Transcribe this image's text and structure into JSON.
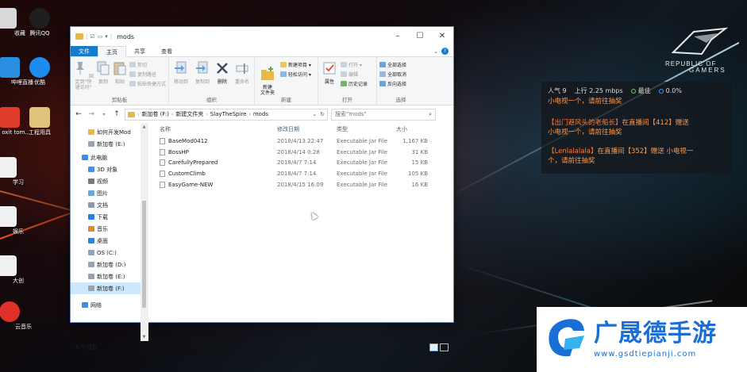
{
  "desktop": {
    "icons": [
      {
        "label": "收藏",
        "color": "#d9d9d9"
      },
      {
        "label": "腾讯QQ",
        "color": "#1f1f1f"
      },
      {
        "label": "哔哩直播",
        "color": "#2a8fe0"
      },
      {
        "label": "优酷",
        "color": "#1d8bf0"
      },
      {
        "label": "oxit tom...",
        "color": "#e03a2a"
      },
      {
        "label": "工程用具",
        "color": "#e0c27a"
      },
      {
        "label": "学习",
        "color": "#f0f0f0"
      },
      {
        "label": "娱乐",
        "color": "#f0f0f0"
      },
      {
        "label": "大创",
        "color": "#f0f0f0"
      },
      {
        "label": "云音乐",
        "color": "#e0302a"
      }
    ]
  },
  "rog": {
    "line1": "REPUBLIC OF",
    "line2": "GAMERS"
  },
  "chat": {
    "viewers_label": "人气",
    "viewers": "9",
    "upload_label": "上行",
    "upload": "2.25 mbps",
    "quality": "最佳",
    "drop": "0.0%",
    "partial_line": "小电视一个，请前往抽奖",
    "messages": [
      {
        "name": "【出门避风头的老船长】",
        "text": "在直播间【412】赠送",
        "text2": "小电视一个，请前往抽奖"
      },
      {
        "name": "【Lenlalalala】",
        "text": "在直播间【352】赠送 小电视一",
        "text2": "个，请前往抽奖"
      }
    ]
  },
  "brand": {
    "title": "广晟德手游",
    "url": "www.gsdtiepianji.com"
  },
  "explorer": {
    "title": "mods",
    "tabs": {
      "file": "文件",
      "home": "主页",
      "share": "共享",
      "view": "查看"
    },
    "ribbon": {
      "clipboard": {
        "label": "剪贴板",
        "pin": "固定到\"快速访问\"",
        "copy": "复制",
        "paste": "粘贴",
        "cut": "剪切",
        "copy_path": "复制路径",
        "paste_shortcut": "粘贴快捷方式"
      },
      "organize": {
        "label": "组织",
        "move_to": "移动到",
        "copy_to": "复制到",
        "delete": "删除",
        "rename": "重命名"
      },
      "new": {
        "label": "新建",
        "new_folder": "新建\n文件夹",
        "new_item": "新建项目 ▾",
        "easy_access": "轻松访问 ▾"
      },
      "open": {
        "label": "打开",
        "properties": "属性",
        "open": "打开 ▾",
        "edit": "编辑",
        "history": "历史记录"
      },
      "select": {
        "label": "选择",
        "select_all": "全部选择",
        "select_none": "全部取消",
        "invert": "反向选择"
      }
    },
    "address": {
      "drive": "新加卷 (F:)",
      "folder1": "新建文件夹",
      "folder2": "SlayTheSpire",
      "folder3": "mods"
    },
    "search_placeholder": "搜索\"mods\"",
    "nav": [
      {
        "label": "如何开发Mod",
        "color": "#e8b84a"
      },
      {
        "label": "新加卷 (E:)",
        "color": "#9aa3ad"
      },
      {
        "label": "此电脑",
        "color": "#3a8ee6"
      },
      {
        "label": "3D 对象",
        "color": "#4a90d9"
      },
      {
        "label": "视频",
        "color": "#7a7a7a"
      },
      {
        "label": "图片",
        "color": "#6aa6d8"
      },
      {
        "label": "文档",
        "color": "#8a9bb0"
      },
      {
        "label": "下载",
        "color": "#2f7fd8"
      },
      {
        "label": "音乐",
        "color": "#d88a2f"
      },
      {
        "label": "桌面",
        "color": "#3a7fd0"
      },
      {
        "label": "OS (C:)",
        "color": "#8fa4bb"
      },
      {
        "label": "新加卷 (D:)",
        "color": "#9aa3ad"
      },
      {
        "label": "新加卷 (E:)",
        "color": "#9aa3ad"
      },
      {
        "label": "新加卷 (F:)",
        "color": "#9aa3ad"
      },
      {
        "label": "网络",
        "color": "#3a8ee6"
      }
    ],
    "columns": {
      "name": "名称",
      "date": "修改日期",
      "type": "类型",
      "size": "大小"
    },
    "files": [
      {
        "name": "BaseMod0412",
        "date": "2018/4/13 22:47",
        "type": "Executable Jar File",
        "size": "1,167 KB"
      },
      {
        "name": "BossHP",
        "date": "2018/4/14 0:28",
        "type": "Executable Jar File",
        "size": "31 KB"
      },
      {
        "name": "CarefullyPrepared",
        "date": "2018/4/7 7:14",
        "type": "Executable Jar File",
        "size": "15 KB"
      },
      {
        "name": "CustomClimb",
        "date": "2018/4/7 7:14",
        "type": "Executable Jar File",
        "size": "105 KB"
      },
      {
        "name": "EasyGame-NEW",
        "date": "2018/4/15 16:09",
        "type": "Executable Jar File",
        "size": "16 KB"
      }
    ],
    "status": "5 个项目"
  }
}
